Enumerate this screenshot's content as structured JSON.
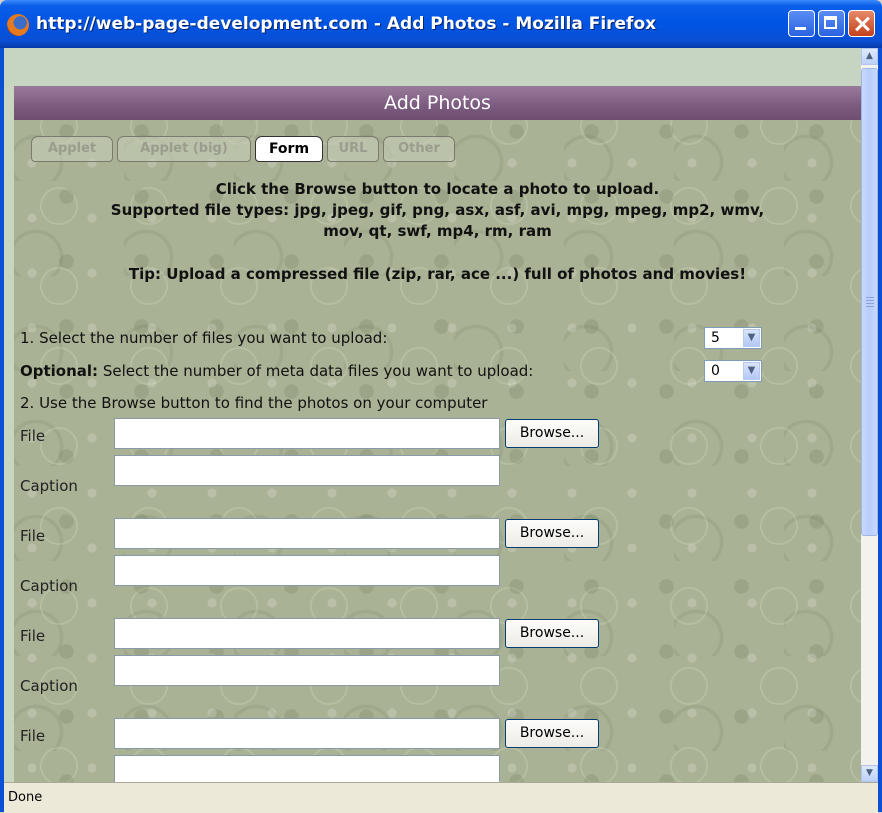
{
  "window": {
    "title": "http://web-page-development.com - Add Photos - Mozilla Firefox"
  },
  "page": {
    "header": "Add Photos",
    "tabs": [
      {
        "label": "Applet",
        "active": false
      },
      {
        "label": "Applet (big)",
        "active": false
      },
      {
        "label": "Form",
        "active": true
      },
      {
        "label": "URL",
        "active": false
      },
      {
        "label": "Other",
        "active": false
      }
    ],
    "intro": {
      "line1": "Click the Browse button to locate a photo to upload.",
      "line2": "Supported file types: jpg, jpeg, gif, png, asx, asf, avi, mpg, mpeg, mp2, wmv,",
      "line3": "mov, qt, swf, mp4, rm, ram",
      "tip": "Tip: Upload a compressed file (zip, rar, ace ...) full of photos and movies!"
    },
    "step1": {
      "label": "1. Select the number of files you want to upload:",
      "value": "5"
    },
    "optional": {
      "bold": "Optional:",
      "label": " Select the number of meta data files you want to upload:",
      "value": "0"
    },
    "step2": {
      "label": "2. Use the Browse button to find the photos on your computer"
    },
    "file_label": "File",
    "caption_label": "Caption",
    "browse_label": "Browse...",
    "file_rows": [
      {
        "file": "",
        "caption": ""
      },
      {
        "file": "",
        "caption": ""
      },
      {
        "file": "",
        "caption": ""
      },
      {
        "file": "",
        "caption": ""
      }
    ]
  },
  "statusbar": {
    "text": "Done"
  }
}
